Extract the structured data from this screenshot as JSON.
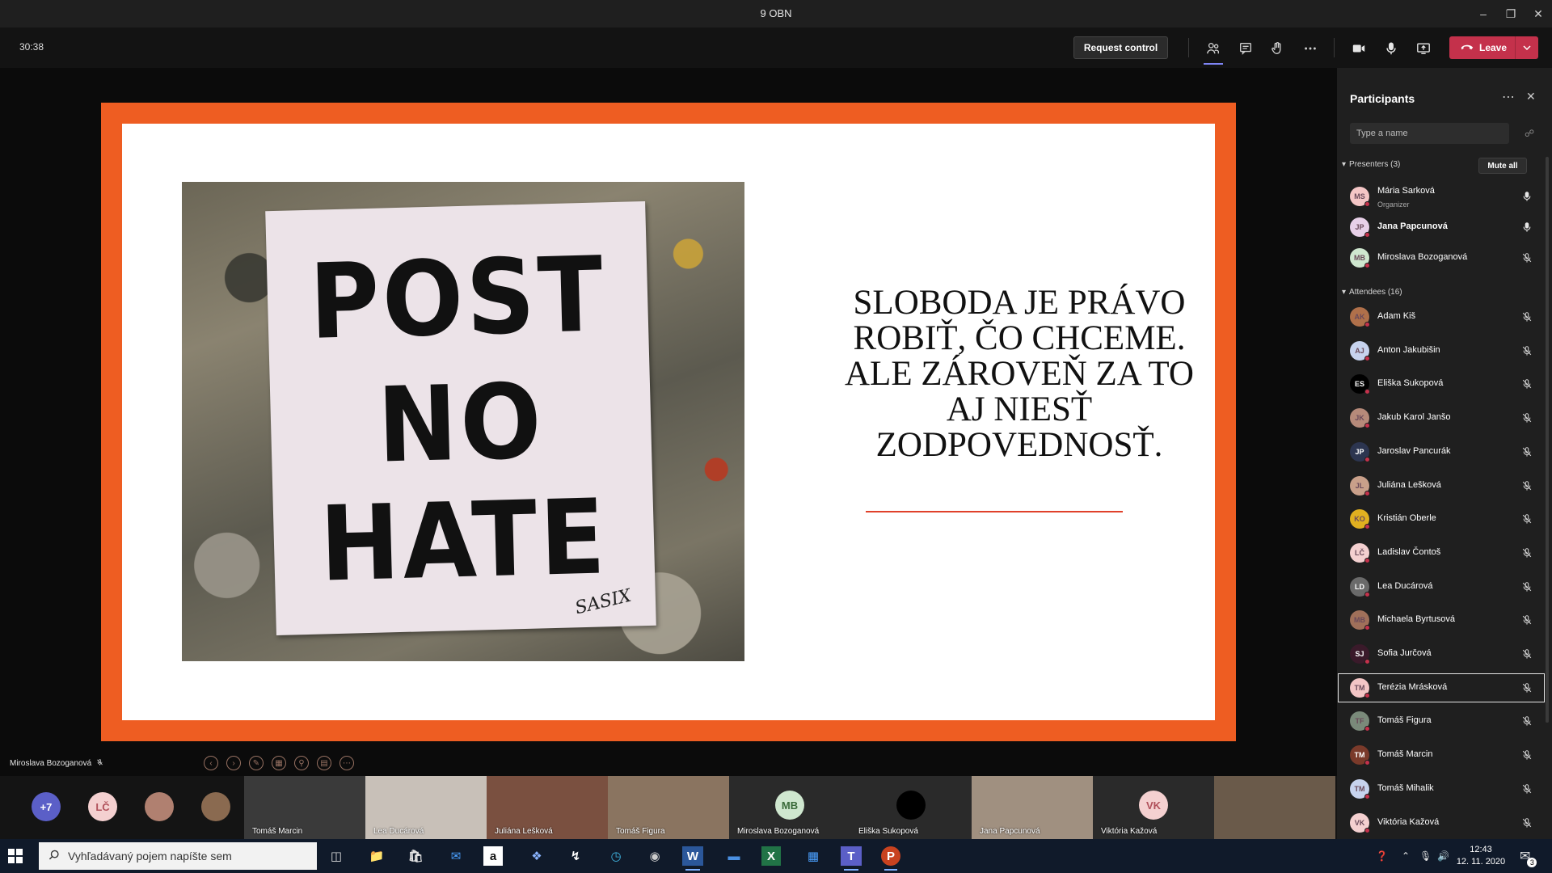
{
  "window": {
    "title": "9 OBN"
  },
  "toolbar": {
    "timer": "30:38",
    "request_control_label": "Request control",
    "leave_label": "Leave"
  },
  "slide": {
    "poster_lines": [
      "POST",
      "NO",
      "HATE"
    ],
    "poster_signature": "SASIX",
    "quote": "SLOBODA JE PRÁVO ROBIŤ, ČO CHCEME. ALE ZÁROVEŇ ZA TO AJ NIESŤ ZODPOVEDNOSŤ.",
    "accent_color": "#ee5d22"
  },
  "presenter_label": "Miroslava Bozoganová",
  "participants_panel": {
    "title": "Participants",
    "search_placeholder": "Type a name",
    "mute_all_label": "Mute all",
    "presenters_header": "Presenters (3)",
    "attendees_header": "Attendees (16)",
    "presenters": [
      {
        "initials": "MS",
        "name": "Mária Sarková",
        "role": "Organizer",
        "mic": "on",
        "avatar_color": "#f4c6c6"
      },
      {
        "initials": "JP",
        "name": "Jana Papcunová",
        "role": "",
        "mic": "on",
        "avatar_color": "#e8d0e8"
      },
      {
        "initials": "MB",
        "name": "Miroslava Bozoganová",
        "role": "",
        "mic": "muted",
        "avatar_color": "#cfe7cf"
      }
    ],
    "attendees": [
      {
        "initials": "AK",
        "name": "Adam Kiš",
        "avatar_color": "#b0704a"
      },
      {
        "initials": "AJ",
        "name": "Anton Jakubišin",
        "avatar_color": "#c7d3ee"
      },
      {
        "initials": "ES",
        "name": "Eliška Sukopová",
        "avatar_color": "#000000"
      },
      {
        "initials": "JK",
        "name": "Jakub Karol Janšo",
        "avatar_color": "#b68a7a"
      },
      {
        "initials": "JP",
        "name": "Jaroslav Pancurák",
        "avatar_color": "#2c3550"
      },
      {
        "initials": "JL",
        "name": "Juliána Lešková",
        "avatar_color": "#c9a08a"
      },
      {
        "initials": "KO",
        "name": "Kristián Oberle",
        "avatar_color": "#e0b020"
      },
      {
        "initials": "LČ",
        "name": "Ladislav Čontoš",
        "avatar_color": "#f4d0d0"
      },
      {
        "initials": "LD",
        "name": "Lea Ducárová",
        "avatar_color": "#6a6a6a"
      },
      {
        "initials": "MB",
        "name": "Michaela Byrtusová",
        "avatar_color": "#a0705a"
      },
      {
        "initials": "SJ",
        "name": "Sofia Jurčová",
        "avatar_color": "#3a1a2a"
      },
      {
        "initials": "TM",
        "name": "Terézia Mrásková",
        "avatar_color": "#f4c6c6"
      },
      {
        "initials": "TF",
        "name": "Tomáš Figura",
        "avatar_color": "#7a8a7a"
      },
      {
        "initials": "TM",
        "name": "Tomáš Marcin",
        "avatar_color": "#7a3a2a"
      },
      {
        "initials": "TM",
        "name": "Tomáš Mihalik",
        "avatar_color": "#c7d3ee"
      },
      {
        "initials": "VK",
        "name": "Viktória Kažová",
        "avatar_color": "#f4d0d0"
      }
    ]
  },
  "video_strip": {
    "overflow_count": "+7",
    "small_avatars": [
      {
        "label": "+7",
        "color": "#5b5fc7"
      },
      {
        "label": "LČ",
        "color": "#f4d0d0"
      },
      {
        "label": "",
        "color": "#b08070"
      },
      {
        "label": "",
        "color": "#8a6a50"
      }
    ],
    "tiles": [
      {
        "name": "Tomáš Marcin",
        "initials": "",
        "color": "#3a3a3a"
      },
      {
        "name": "Lea Ducárová",
        "initials": "",
        "color": "#c8c0b8"
      },
      {
        "name": "Juliána Lešková",
        "initials": "",
        "color": "#7a5040"
      },
      {
        "name": "Tomáš Figura",
        "initials": "",
        "color": "#8a7460"
      },
      {
        "name": "Miroslava Bozoganová",
        "initials": "MB",
        "color": "#2a2a2a"
      },
      {
        "name": "Eliška Sukopová",
        "initials": "",
        "color": "#2a2a2a"
      },
      {
        "name": "Jana Papcunová",
        "initials": "",
        "color": "#a09080"
      },
      {
        "name": "Viktória Kažová",
        "initials": "VK",
        "color": "#2a2a2a"
      },
      {
        "name": "",
        "initials": "",
        "color": "#6a5a4a"
      }
    ]
  },
  "taskbar": {
    "search_placeholder": "Vyhľadávaný pojem napíšte sem",
    "time": "12:43",
    "date": "12. 11. 2020",
    "notification_count": "3"
  }
}
